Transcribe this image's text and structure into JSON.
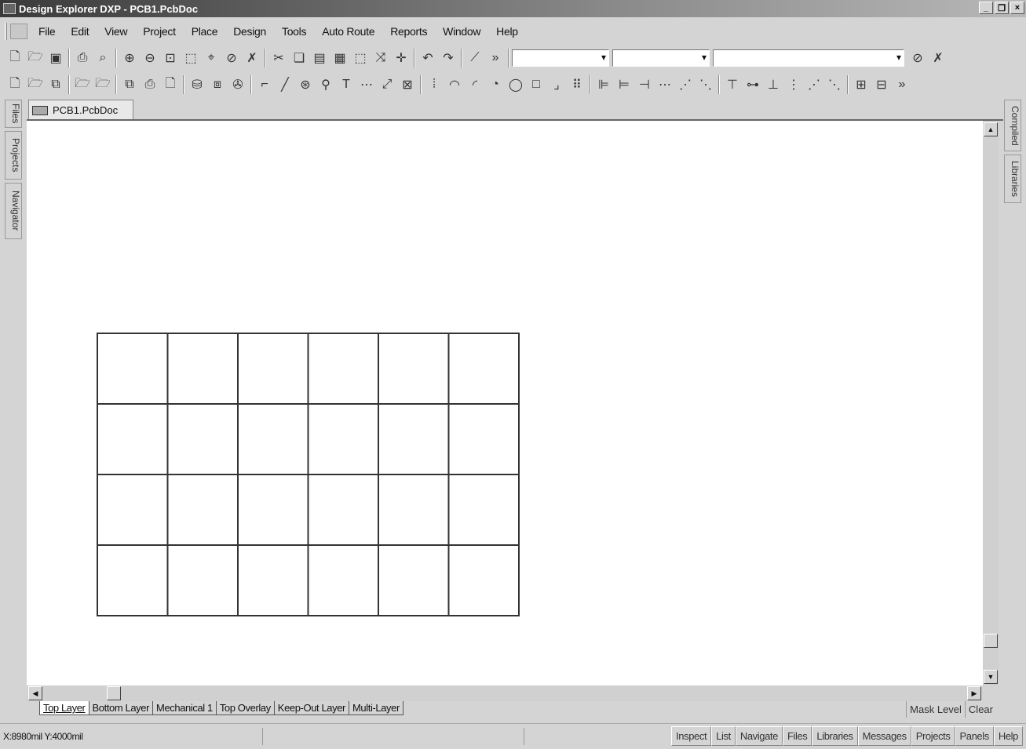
{
  "window": {
    "title": "Design Explorer DXP - PCB1.PcbDoc"
  },
  "menu": [
    "File",
    "Edit",
    "View",
    "Project",
    "Place",
    "Design",
    "Tools",
    "Auto Route",
    "Reports",
    "Window",
    "Help"
  ],
  "left_panels": [
    "Files",
    "Projects",
    "Navigator"
  ],
  "right_panels": [
    "Compiled",
    "Libraries"
  ],
  "document": {
    "tab_label": "PCB1.PcbDoc"
  },
  "board": {
    "columns": 6,
    "rows": 4
  },
  "layers": [
    "Top Layer",
    "Bottom Layer",
    "Mechanical 1",
    "Top Overlay",
    "Keep-Out Layer",
    "Multi-Layer"
  ],
  "mask": {
    "level": "Mask Level",
    "clear": "Clear"
  },
  "status": {
    "coords": "X:8980mil Y:4000mil"
  },
  "panel_buttons": [
    "Inspect",
    "List",
    "Navigate",
    "Files",
    "Libraries",
    "Messages",
    "Projects",
    "Panels",
    "Help"
  ]
}
